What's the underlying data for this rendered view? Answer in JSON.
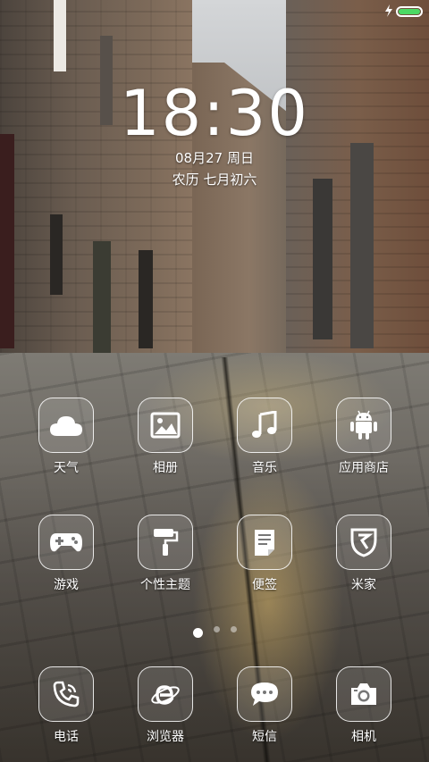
{
  "status_bar": {
    "battery_level": 1.0,
    "battery_color": "#4cd964",
    "charging": true
  },
  "clock": {
    "time": "18:30",
    "date": "08月27 周日",
    "lunar": "农历 七月初六"
  },
  "home": {
    "apps": [
      {
        "label": "天气",
        "icon": "cloud-icon"
      },
      {
        "label": "相册",
        "icon": "picture-icon"
      },
      {
        "label": "音乐",
        "icon": "music-note-icon"
      },
      {
        "label": "应用商店",
        "icon": "android-icon"
      },
      {
        "label": "游戏",
        "icon": "gamepad-icon"
      },
      {
        "label": "个性主题",
        "icon": "paint-roller-icon"
      },
      {
        "label": "便签",
        "icon": "note-icon"
      },
      {
        "label": "米家",
        "icon": "mijia-icon"
      }
    ],
    "page_indicator": {
      "pages": 3,
      "current": 1
    }
  },
  "dock": {
    "apps": [
      {
        "label": "电话",
        "icon": "phone-icon"
      },
      {
        "label": "浏览器",
        "icon": "browser-icon"
      },
      {
        "label": "短信",
        "icon": "message-icon"
      },
      {
        "label": "相机",
        "icon": "camera-icon"
      }
    ]
  }
}
